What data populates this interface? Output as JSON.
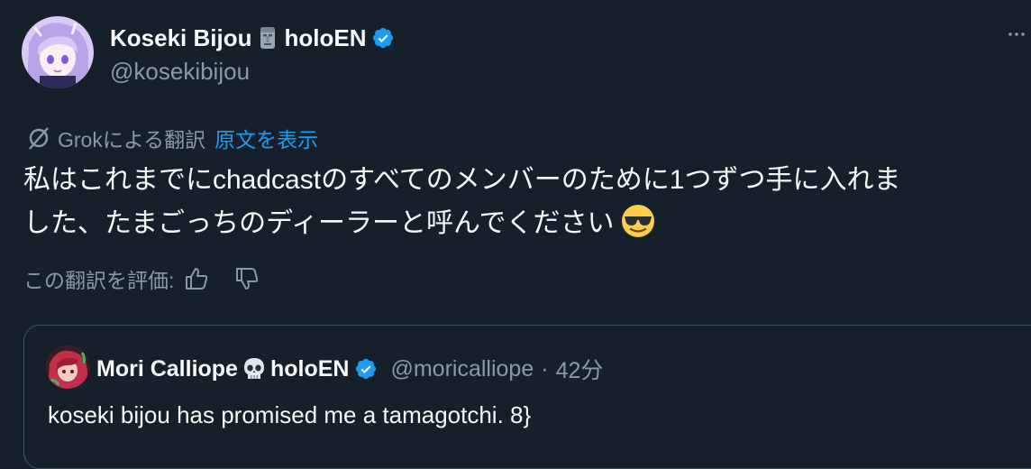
{
  "author": {
    "display_name": "Koseki Bijou",
    "name_suffix": "holoEN",
    "name_emoji": "moai-icon",
    "handle": "@kosekibijou",
    "verified": true
  },
  "translation": {
    "source_label": "Grokによる翻訳",
    "show_original_label": "原文を表示",
    "rate_label": "この翻訳を評価:"
  },
  "tweet": {
    "line1": "私はこれまでにchadcastのすべてのメンバーのために1つずつ手に入れま",
    "line2": "した、たまごっちのディーラーと呼んでください",
    "emoji": "smiling-face-with-sunglasses-icon"
  },
  "quoted_tweet": {
    "display_name": "Mori Calliope",
    "name_suffix": "holoEN",
    "name_emoji": "skull-icon",
    "handle": "@moricalliope",
    "separator": "·",
    "time": "42分",
    "text": "koseki bijou has promised me a tamagotchi. 8}",
    "verified": true
  },
  "colors": {
    "background": "#15202b",
    "text": "#f7f9f9",
    "muted": "#8b98a5",
    "link": "#1d9bf0",
    "verified": "#1d9bf0",
    "border": "#425364"
  }
}
